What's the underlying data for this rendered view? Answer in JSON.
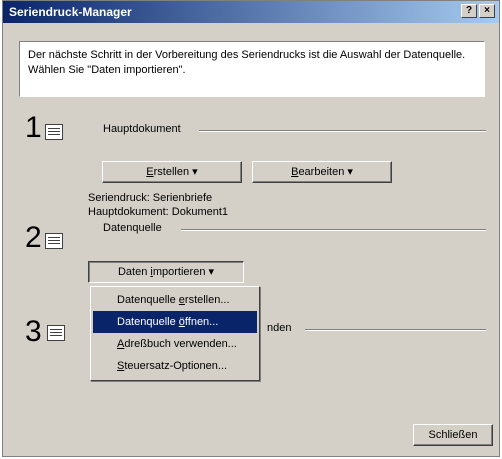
{
  "window": {
    "title": "Seriendruck-Manager",
    "help_label": "?",
    "close_label": "×"
  },
  "info_text": "Der nächste Schritt in der Vorbereitung des Seriendrucks ist die Auswahl der Datenquelle. Wählen Sie \"Daten importieren\".",
  "steps": [
    {
      "number": "1",
      "label": "Hauptdokument",
      "icon": "main-document-icon"
    },
    {
      "number": "2",
      "label": "Datenquelle",
      "icon": "data-source-icon"
    },
    {
      "number": "3",
      "label": "nden",
      "icon": "merge-icon"
    }
  ],
  "step1": {
    "create_button": {
      "prefix": "",
      "accel": "E",
      "rest": "rstellen ▾"
    },
    "edit_button": {
      "prefix": "",
      "accel": "B",
      "rest": "earbeiten ▾"
    },
    "info_line1": "Seriendruck: Serienbriefe",
    "info_line2": "Hauptdokument: Dokument1"
  },
  "step2": {
    "import_button": {
      "prefix": "Daten ",
      "accel": "i",
      "rest": "mportieren ▾"
    }
  },
  "dropdown_menu": {
    "items": [
      {
        "prefix": "Datenquelle ",
        "accel": "e",
        "rest": "rstellen...",
        "selected": false
      },
      {
        "prefix": "Datenquelle ",
        "accel": "ö",
        "rest": "ffnen...",
        "selected": true
      },
      {
        "prefix": "",
        "accel": "A",
        "rest": "dreßbuch verwenden...",
        "selected": false
      },
      {
        "prefix": "",
        "accel": "S",
        "rest": "teuersatz-Optionen...",
        "selected": false
      }
    ]
  },
  "close_button_label": "Schließen",
  "colors": {
    "titlebar_start": "#0a246a",
    "titlebar_end": "#a6caf0",
    "face": "#d4d0c8",
    "highlight": "#0a246a"
  }
}
